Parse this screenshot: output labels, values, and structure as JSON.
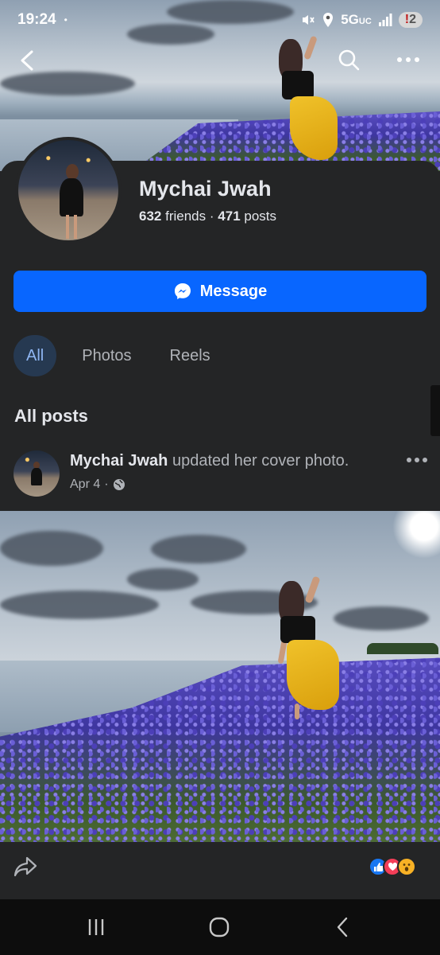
{
  "status_bar": {
    "time": "19:24",
    "dot": "•",
    "network": "5G",
    "network_suffix": "UC",
    "alert_mark": "!",
    "notification_count": "2"
  },
  "profile": {
    "name": "Mychai Jwah",
    "friends_count": "632",
    "friends_label": "friends",
    "separator": "·",
    "posts_count": "471",
    "posts_label": "posts"
  },
  "message_button": {
    "label": "Message"
  },
  "tabs": [
    {
      "label": "All",
      "active": true
    },
    {
      "label": "Photos",
      "active": false
    },
    {
      "label": "Reels",
      "active": false
    }
  ],
  "section_title": "All posts",
  "post": {
    "author": "Mychai Jwah",
    "action": "updated her cover photo.",
    "date": "Apr 4",
    "date_separator": "·",
    "privacy_icon": "globe-icon"
  },
  "reactions": [
    "like-icon",
    "love-icon",
    "wow-icon"
  ],
  "colors": {
    "accent": "#0866ff",
    "background": "#242526",
    "active_tab_bg": "#263951",
    "active_tab_text": "#8fb6f3",
    "secondary_text": "#b0b3b8"
  }
}
